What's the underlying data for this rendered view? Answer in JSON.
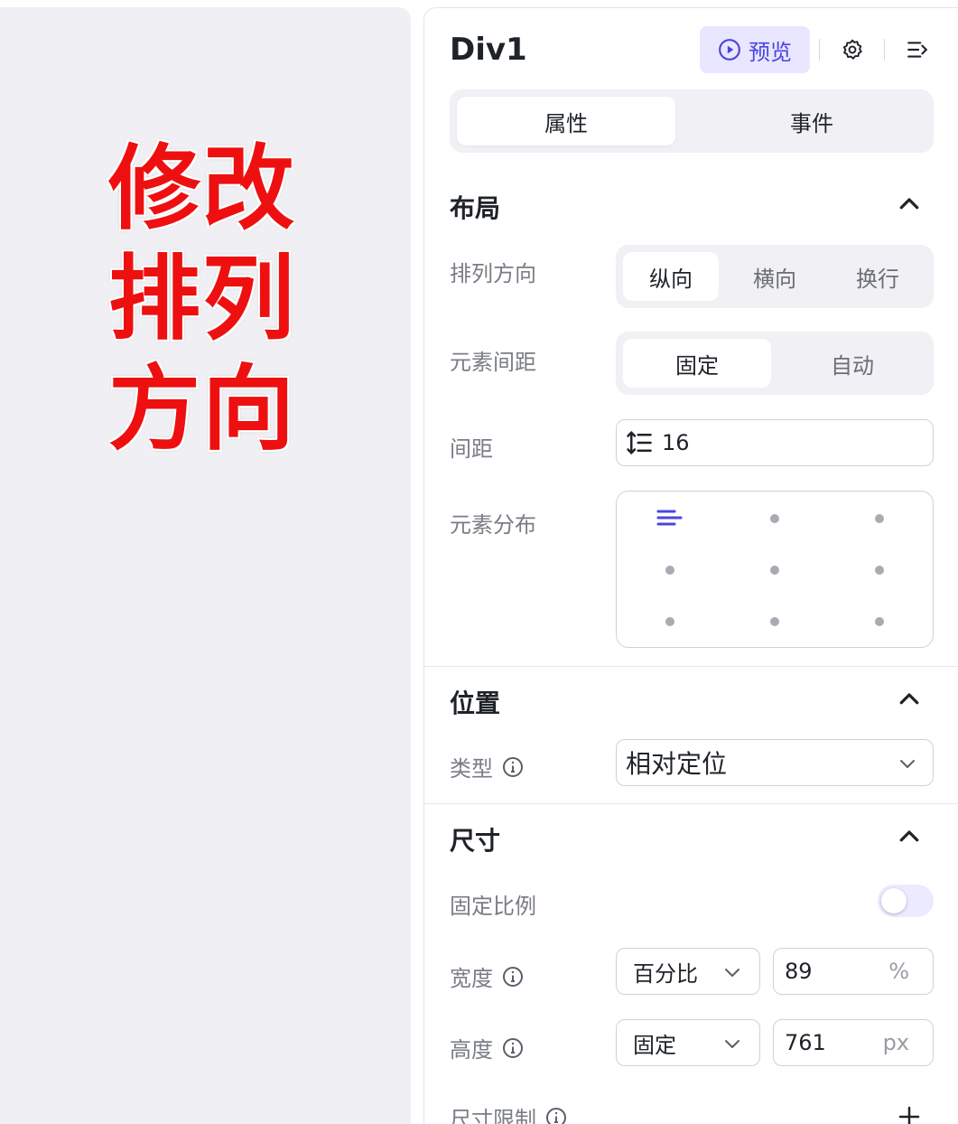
{
  "overlay": {
    "lines": [
      "修改",
      "排列",
      "方向"
    ]
  },
  "header": {
    "title": "Div1",
    "preview_label": "预览"
  },
  "tabs": [
    {
      "label": "属性",
      "active": true
    },
    {
      "label": "事件",
      "active": false
    }
  ],
  "layout": {
    "title": "布局",
    "direction": {
      "label": "排列方向",
      "options": [
        "纵向",
        "横向",
        "换行"
      ],
      "selected": "纵向"
    },
    "spacing_mode": {
      "label": "元素间距",
      "options": [
        "固定",
        "自动"
      ],
      "selected": "固定"
    },
    "gap": {
      "label": "间距",
      "value": "16"
    },
    "distribution": {
      "label": "元素分布",
      "selected_cell": "top-left"
    }
  },
  "position": {
    "title": "位置",
    "type": {
      "label": "类型",
      "value": "相对定位"
    }
  },
  "size": {
    "title": "尺寸",
    "lock_ratio": {
      "label": "固定比例",
      "on": false
    },
    "width": {
      "label": "宽度",
      "mode": "百分比",
      "value": "89",
      "unit": "%"
    },
    "height": {
      "label": "高度",
      "mode": "固定",
      "value": "761",
      "unit": "px"
    },
    "limit": {
      "label": "尺寸限制"
    }
  },
  "colors": {
    "accent": "#4c44e0",
    "accent_bg": "#e8e7ff",
    "overlay_text": "#ee1010"
  }
}
